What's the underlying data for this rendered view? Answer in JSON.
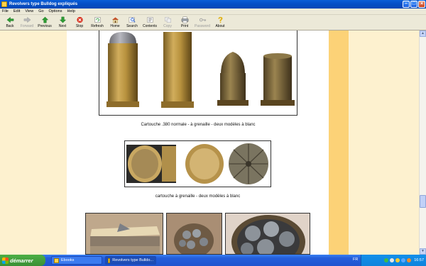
{
  "window": {
    "title": "Revolvers type Bulldog expliqués"
  },
  "menu": [
    "File",
    "Edit",
    "View",
    "Go",
    "Options",
    "Help"
  ],
  "toolbar": {
    "buttons": [
      {
        "label": "Back",
        "icon": "back-arrow-icon",
        "enabled": true
      },
      {
        "label": "Forward",
        "icon": "forward-arrow-icon",
        "enabled": false
      },
      {
        "label": "Previous",
        "icon": "up-arrow-icon",
        "enabled": true
      },
      {
        "label": "Next",
        "icon": "down-arrow-icon",
        "enabled": true
      },
      {
        "label": "Stop",
        "icon": "stop-icon",
        "enabled": true
      },
      {
        "label": "Refresh",
        "icon": "refresh-icon",
        "enabled": true
      },
      {
        "label": "Home",
        "icon": "home-icon",
        "enabled": true
      },
      {
        "label": "Search",
        "icon": "search-icon",
        "enabled": true
      },
      {
        "label": "Contents",
        "icon": "contents-icon",
        "enabled": true
      },
      {
        "label": "Copy",
        "icon": "copy-icon",
        "enabled": false
      },
      {
        "label": "Print",
        "icon": "print-icon",
        "enabled": true
      },
      {
        "label": "Password",
        "icon": "key-icon",
        "enabled": false
      },
      {
        "label": "About",
        "icon": "about-icon",
        "enabled": true
      }
    ]
  },
  "content": {
    "caption1": "Cartouche .380 normale - à grenaille - deux modèles à blanc",
    "caption2": "cartouche à grenaille - deux modèles à blanc"
  },
  "taskbar": {
    "start_label": "démarrer",
    "tasks": [
      {
        "label": "Ebooks",
        "active": false
      },
      {
        "label": "Revolvers type Bulldo...",
        "active": true
      }
    ],
    "language": "FR",
    "clock": "16:57"
  },
  "colors": {
    "titlebar": "#0550c8",
    "page_background": "#fdf1cf",
    "accent_band": "#fcd277",
    "taskbar": "#245edb",
    "start_button": "#3a8f35"
  }
}
